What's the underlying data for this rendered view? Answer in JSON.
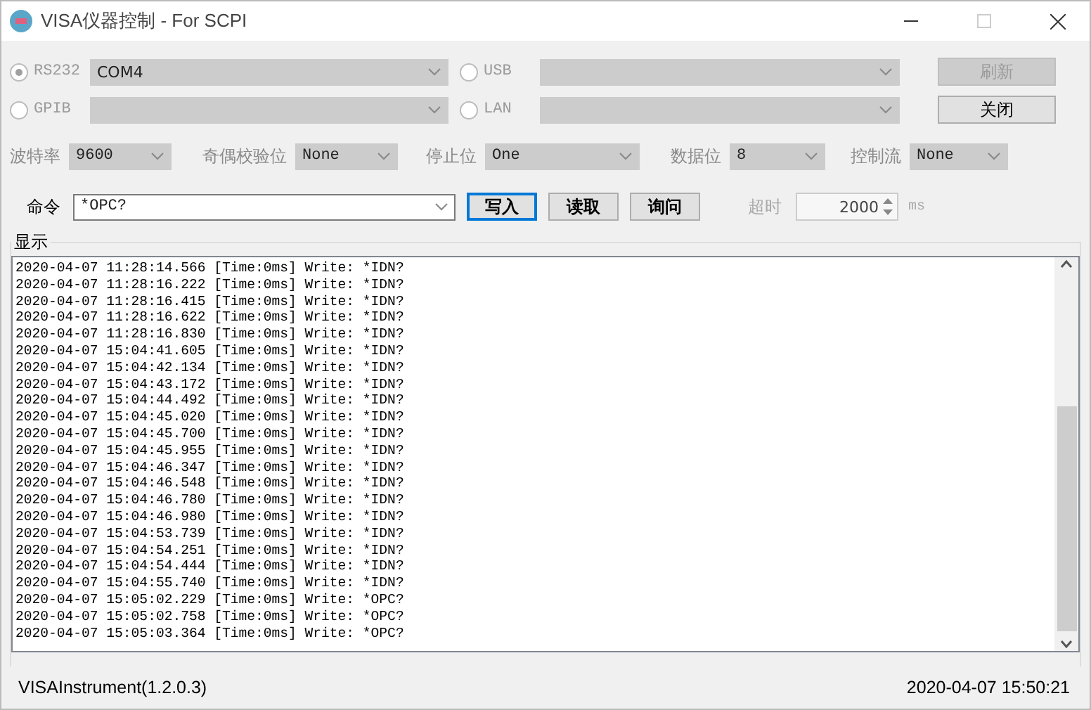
{
  "window": {
    "title": "VISA仪器控制 - For SCPI",
    "maximize_disabled": true
  },
  "interfaces": [
    {
      "label": "RS232",
      "selected": true,
      "disabled": true,
      "value": "COM4"
    },
    {
      "label": "USB",
      "selected": false,
      "disabled": true
    },
    {
      "label": "GPIB",
      "selected": false,
      "disabled": true
    },
    {
      "label": "LAN",
      "selected": false,
      "disabled": true
    }
  ],
  "side_buttons": [
    {
      "label": "刷新",
      "disabled": true
    },
    {
      "label": "关闭",
      "disabled": false
    }
  ],
  "serial_settings": [
    {
      "label": "波特率",
      "value": "9600"
    },
    {
      "label": "奇偶校验位",
      "value": "None"
    },
    {
      "label": "停止位",
      "value": "One"
    },
    {
      "label": "数据位",
      "value": "8"
    },
    {
      "label": "控制流",
      "value": "None"
    }
  ],
  "command": {
    "label": "命令",
    "value": "*OPC?"
  },
  "command_buttons": [
    {
      "label": "写入",
      "default": true
    },
    {
      "label": "读取",
      "default": false
    },
    {
      "label": "询问",
      "default": false
    }
  ],
  "timeout": {
    "label": "超时",
    "value": "2000",
    "unit": "ms"
  },
  "display": {
    "title": "显示",
    "lines": [
      "2020-04-07 11:28:14.566 [Time:0ms] Write: *IDN?",
      "2020-04-07 11:28:16.222 [Time:0ms] Write: *IDN?",
      "2020-04-07 11:28:16.415 [Time:0ms] Write: *IDN?",
      "2020-04-07 11:28:16.622 [Time:0ms] Write: *IDN?",
      "2020-04-07 11:28:16.830 [Time:0ms] Write: *IDN?",
      "2020-04-07 15:04:41.605 [Time:0ms] Write: *IDN?",
      "2020-04-07 15:04:42.134 [Time:0ms] Write: *IDN?",
      "2020-04-07 15:04:43.172 [Time:0ms] Write: *IDN?",
      "2020-04-07 15:04:44.492 [Time:0ms] Write: *IDN?",
      "2020-04-07 15:04:45.020 [Time:0ms] Write: *IDN?",
      "2020-04-07 15:04:45.700 [Time:0ms] Write: *IDN?",
      "2020-04-07 15:04:45.955 [Time:0ms] Write: *IDN?",
      "2020-04-07 15:04:46.347 [Time:0ms] Write: *IDN?",
      "2020-04-07 15:04:46.548 [Time:0ms] Write: *IDN?",
      "2020-04-07 15:04:46.780 [Time:0ms] Write: *IDN?",
      "2020-04-07 15:04:46.980 [Time:0ms] Write: *IDN?",
      "2020-04-07 15:04:53.739 [Time:0ms] Write: *IDN?",
      "2020-04-07 15:04:54.251 [Time:0ms] Write: *IDN?",
      "2020-04-07 15:04:54.444 [Time:0ms] Write: *IDN?",
      "2020-04-07 15:04:55.740 [Time:0ms] Write: *IDN?",
      "2020-04-07 15:05:02.229 [Time:0ms] Write: *OPC?",
      "2020-04-07 15:05:02.758 [Time:0ms] Write: *OPC?",
      "2020-04-07 15:05:03.364 [Time:0ms] Write: *OPC?"
    ]
  },
  "status_bar": {
    "app_version": "VISAInstrument(1.2.0.3)",
    "datetime": "2020-04-07 15:50:21"
  }
}
